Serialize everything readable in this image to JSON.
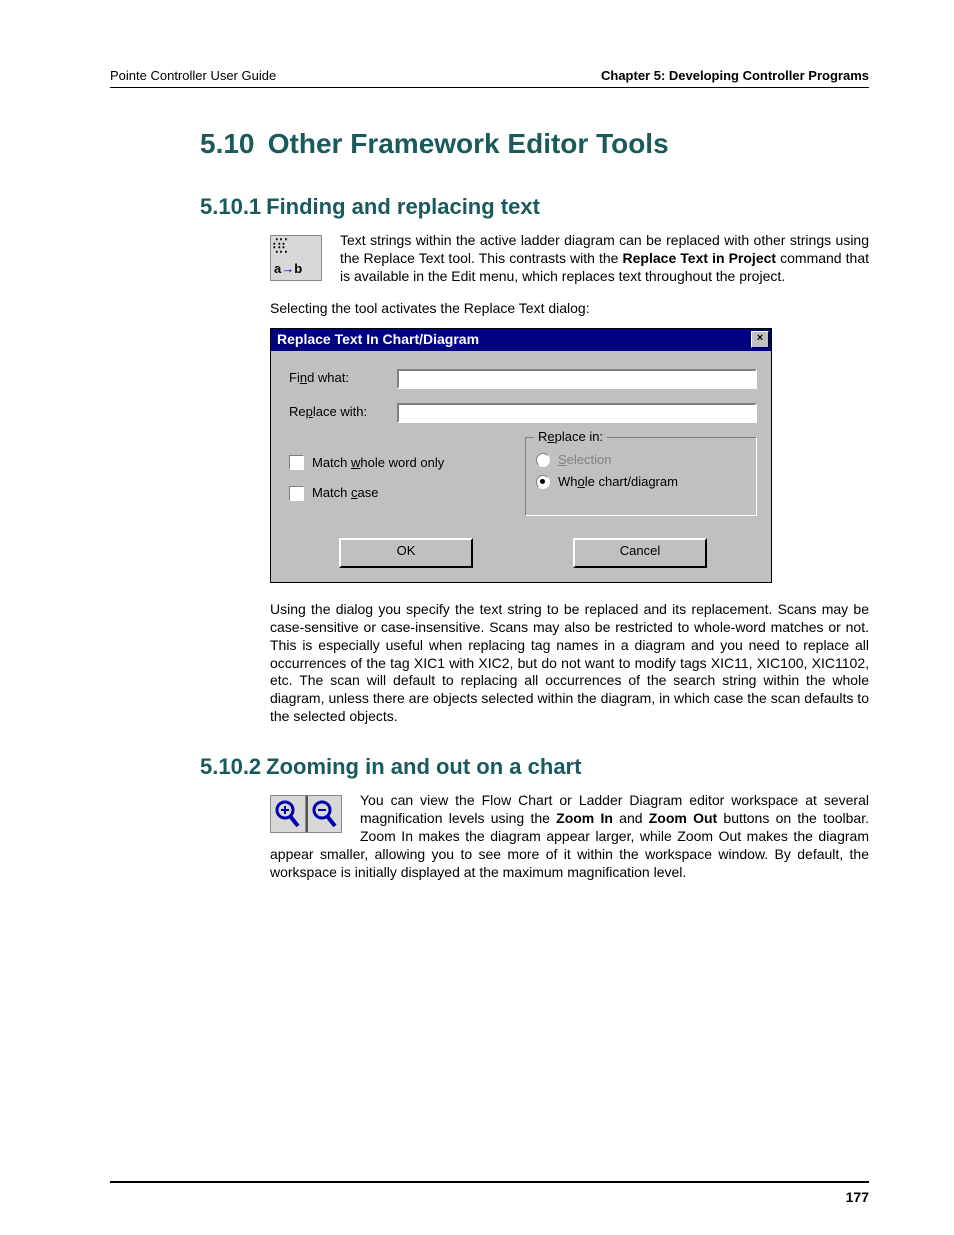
{
  "header": {
    "left": "Pointe Controller User Guide",
    "right": "Chapter 5: Developing Controller Programs"
  },
  "section": {
    "num": "5.10",
    "title": "Other Framework Editor Tools"
  },
  "sub1": {
    "num": "5.10.1",
    "title": "Finding and replacing text",
    "para1a": "Text strings within the active ladder diagram can be replaced with other strings using the Replace Text tool. This contrasts with the ",
    "para1bold": "Replace Text in Project",
    "para1b": " command that is available in the Edit menu, which replaces text throughout the project.",
    "para2": "Selecting the tool activates the Replace Text dialog:",
    "para3": "Using the dialog you specify the text string to be replaced and its replacement. Scans may be case-sensitive or case-insensitive. Scans may also be restricted to whole-word matches or not. This is especially useful when replacing tag names in a diagram and you need to replace all occurrences of the tag XIC1 with XIC2, but do not want to modify tags XIC11, XIC100, XIC1102, etc. The scan will default to replacing all occurrences of the search string within the whole diagram, unless there are objects selected within the diagram, in which case the scan defaults to the selected objects."
  },
  "dialog": {
    "title": "Replace Text In Chart/Diagram",
    "close": "×",
    "find_label_pre": "Fi",
    "find_label_u": "n",
    "find_label_post": "d what:",
    "replace_label_pre": "Re",
    "replace_label_u": "p",
    "replace_label_post": "lace with:",
    "chk1_pre": "Match ",
    "chk1_u": "w",
    "chk1_post": "hole word only",
    "chk2_pre": "Match ",
    "chk2_u": "c",
    "chk2_post": "ase",
    "group_pre": "R",
    "group_u": "e",
    "group_post": "place in:",
    "radio1_u": "S",
    "radio1_post": "election",
    "radio2_pre": "Wh",
    "radio2_u": "o",
    "radio2_post": "le chart/diagram",
    "ok": "OK",
    "cancel": "Cancel"
  },
  "sub2": {
    "num": "5.10.2",
    "title": "Zooming in and out on a chart",
    "para_a": "You can view the Flow Chart or Ladder Diagram editor workspace at several magnification levels using the ",
    "bold1": "Zoom In",
    "mid": " and ",
    "bold2": "Zoom Out",
    "para_b": " buttons on the toolbar. Zoom In makes the diagram appear larger, while Zoom Out makes the diagram appear smaller, allowing you to see more of it within the workspace window. By default, the workspace is initially displayed at the maximum magnification level."
  },
  "page_number": "177"
}
